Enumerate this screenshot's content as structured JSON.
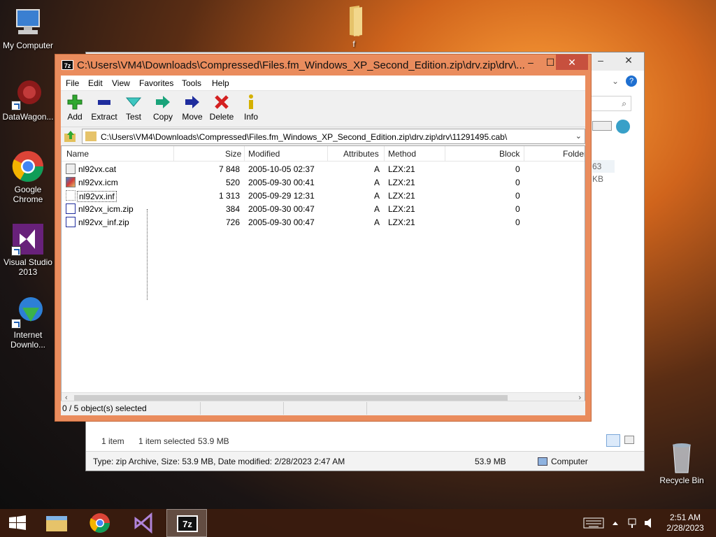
{
  "desktop": {
    "icons": [
      {
        "label": "My Computer",
        "icon": "computer-icon"
      },
      {
        "label": "DataWagon...",
        "icon": "datawagon-icon"
      },
      {
        "label": "Google Chrome",
        "icon": "chrome-icon"
      },
      {
        "label": "Visual Studio 2013",
        "icon": "visual-studio-icon"
      },
      {
        "label": "Internet Downlo...",
        "icon": "internet-download-manager-icon"
      },
      {
        "label": "f",
        "icon": "folder-icon"
      },
      {
        "label": "Recycle Bin",
        "icon": "recycle-bin-icon"
      }
    ]
  },
  "explorer": {
    "status_size_partial": "63 KB",
    "items_count": "1 item",
    "selected": "1 item selected",
    "selected_size": "53.9 MB",
    "detail": "Type: zip Archive, Size: 53.9 MB, Date modified: 2/28/2023 2:47 AM",
    "detail_size": "53.9 MB",
    "location": "Computer",
    "minimize": "–",
    "close": "✕"
  },
  "sevenzip": {
    "app_icon_text": "7z",
    "title": "C:\\Users\\VM4\\Downloads\\Compressed\\Files.fm_Windows_XP_Second_Edition.zip\\drv.zip\\drv\\...",
    "controls": {
      "minimize": "–",
      "maximize": "☐",
      "close": "✕"
    },
    "menu": [
      "File",
      "Edit",
      "View",
      "Favorites",
      "Tools",
      "Help"
    ],
    "toolbar": [
      {
        "label": "Add",
        "icon": "plus-icon",
        "color": "#2fa82f"
      },
      {
        "label": "Extract",
        "icon": "minus-icon",
        "color": "#1f2d9e"
      },
      {
        "label": "Test",
        "icon": "test-icon",
        "color": "#1aa3a0"
      },
      {
        "label": "Copy",
        "icon": "copy-arrow-icon",
        "color": "#1aa37a"
      },
      {
        "label": "Move",
        "icon": "move-arrow-icon",
        "color": "#1f2d9e"
      },
      {
        "label": "Delete",
        "icon": "delete-icon",
        "color": "#d42020"
      },
      {
        "label": "Info",
        "icon": "info-icon",
        "color": "#d4b000"
      }
    ],
    "address": "C:\\Users\\VM4\\Downloads\\Compressed\\Files.fm_Windows_XP_Second_Edition.zip\\drv.zip\\drv\\11291495.cab\\",
    "columns": [
      "Name",
      "Size",
      "Modified",
      "Attributes",
      "Method",
      "Block",
      "Folder"
    ],
    "files": [
      {
        "name": "nl92vx.cat",
        "size": "7 848",
        "modified": "2005-10-05 02:37",
        "attributes": "A",
        "method": "LZX:21",
        "block": "0"
      },
      {
        "name": "nl92vx.icm",
        "size": "520",
        "modified": "2005-09-30 00:41",
        "attributes": "A",
        "method": "LZX:21",
        "block": "0"
      },
      {
        "name": "nl92vx.inf",
        "size": "1 313",
        "modified": "2005-09-29 12:31",
        "attributes": "A",
        "method": "LZX:21",
        "block": "0"
      },
      {
        "name": "nl92vx_icm.zip",
        "size": "384",
        "modified": "2005-09-30 00:47",
        "attributes": "A",
        "method": "LZX:21",
        "block": "0"
      },
      {
        "name": "nl92vx_inf.zip",
        "size": "726",
        "modified": "2005-09-30 00:47",
        "attributes": "A",
        "method": "LZX:21",
        "block": "0"
      }
    ],
    "status": "0 / 5 object(s) selected"
  },
  "taskbar": {
    "items": [
      "start-button",
      "file-explorer",
      "google-chrome",
      "visual-studio",
      "7-zip"
    ],
    "time": "2:51 AM",
    "date": "2/28/2023"
  }
}
